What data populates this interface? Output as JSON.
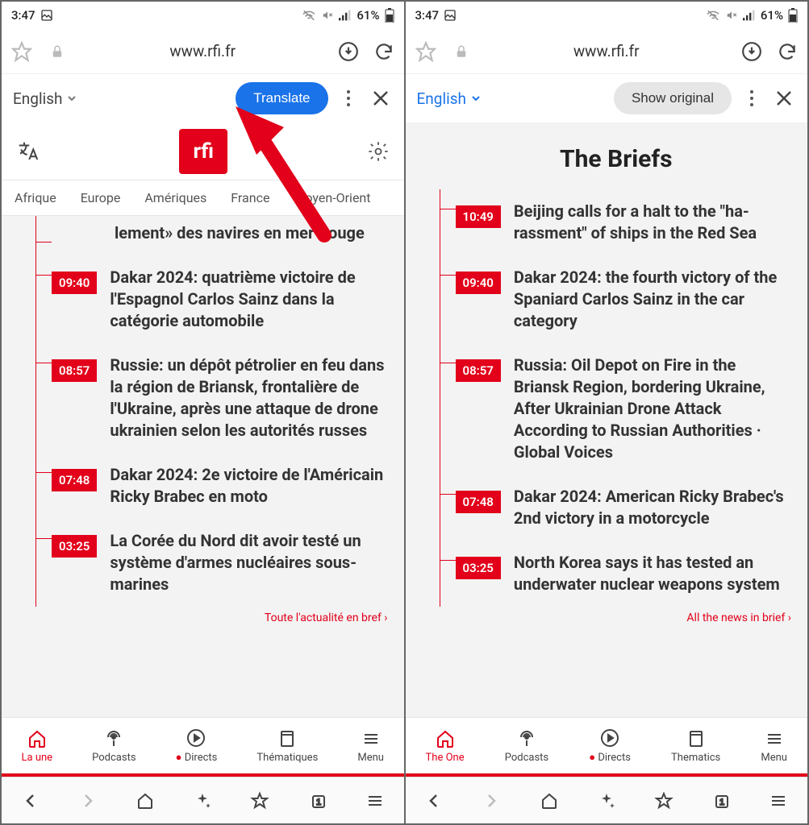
{
  "status": {
    "time": "3:47",
    "battery": "61%"
  },
  "url": "www.rfi.fr",
  "left": {
    "translate": {
      "lang": "English",
      "action": "Translate"
    },
    "tabs": [
      "Afrique",
      "Europe",
      "Amériques",
      "France",
      "Moyen-Orient"
    ],
    "news": [
      {
        "time": "",
        "headline": "lement» des navires en mer Rouge",
        "partial": true
      },
      {
        "time": "09:40",
        "headline": "Dakar 2024: quatrième victoire de l'Espagnol Carlos Sainz dans la catégorie automobile"
      },
      {
        "time": "08:57",
        "headline": "Russie: un dépôt pétrolier en feu dans la région de Briansk, fronta­lière de l'Ukraine, après une at­taque de drone ukrainien selon les autorités russes"
      },
      {
        "time": "07:48",
        "headline": "Dakar 2024: 2e victoire de l'Amé­ricain Ricky Brabec en moto"
      },
      {
        "time": "03:25",
        "headline": "La Corée du Nord dit avoir testé un système d'armes nucléaires sous-marines"
      }
    ],
    "more": "Toute l'actualité en bref",
    "appnav": [
      "La une",
      "Podcasts",
      "Directs",
      "Thématiques",
      "Menu"
    ]
  },
  "right": {
    "translate": {
      "lang": "English",
      "action": "Show original"
    },
    "section_title": "The Briefs",
    "news": [
      {
        "time": "10:49",
        "headline": "Beijing calls for a halt to the \"ha­rassment\" of ships in the Red Sea"
      },
      {
        "time": "09:40",
        "headline": "Dakar 2024: the fourth victory of the Spaniard Carlos Sainz in the car category"
      },
      {
        "time": "08:57",
        "headline": "Russia: Oil Depot on Fire in the Briansk Region, bordering Ukraine, After Ukrainian Drone Attack According to Russian Au­thorities · Global Voices"
      },
      {
        "time": "07:48",
        "headline": "Dakar 2024: American Ricky Bra­bec's 2nd victory in a motorcycle"
      },
      {
        "time": "03:25",
        "headline": "North Korea says it has tested an underwater nuclear weapons system"
      }
    ],
    "more": "All the news in brief",
    "appnav": [
      "The One",
      "Podcasts",
      "Directs",
      "Thematics",
      "Menu"
    ]
  },
  "logo": "rfi",
  "live_dot_label": "●"
}
